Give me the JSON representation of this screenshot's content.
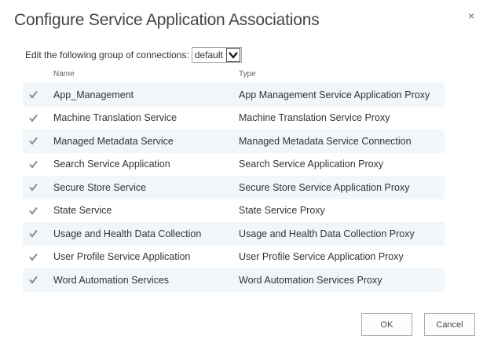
{
  "dialog": {
    "title": "Configure Service Application Associations",
    "close_glyph": "×"
  },
  "group": {
    "label": "Edit the following group of connections:",
    "selected": "default"
  },
  "table": {
    "columns": {
      "name": "Name",
      "type": "Type"
    },
    "rows": [
      {
        "name": "App_Management",
        "type": "App Management Service Application Proxy",
        "checked": true
      },
      {
        "name": "Machine Translation Service",
        "type": "Machine Translation Service Proxy",
        "checked": true
      },
      {
        "name": "Managed Metadata Service",
        "type": "Managed Metadata Service Connection",
        "checked": true
      },
      {
        "name": "Search Service Application",
        "type": "Search Service Application Proxy",
        "checked": true
      },
      {
        "name": "Secure Store Service",
        "type": "Secure Store Service Application Proxy",
        "checked": true
      },
      {
        "name": "State Service",
        "type": "State Service Proxy",
        "checked": true
      },
      {
        "name": "Usage and Health Data Collection",
        "type": "Usage and Health Data Collection Proxy",
        "checked": true
      },
      {
        "name": "User Profile Service Application",
        "type": "User Profile Service Application Proxy",
        "checked": true
      },
      {
        "name": "Word Automation Services",
        "type": "Word Automation Services Proxy",
        "checked": true
      }
    ]
  },
  "buttons": {
    "ok": "OK",
    "cancel": "Cancel"
  },
  "icons": {
    "close": "close-icon",
    "dropdown": "chevron-down-icon",
    "checkbox": "checkmark-icon"
  },
  "colors": {
    "row_stripe": "#f1f6fb",
    "checkbox_check": "#8a8a8a"
  }
}
